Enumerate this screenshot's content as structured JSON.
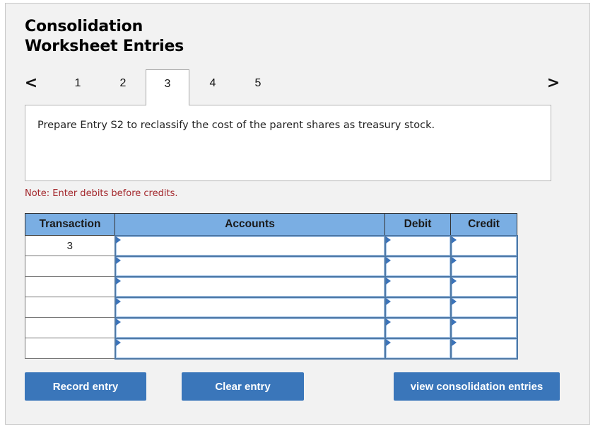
{
  "header": {
    "title_line1": "Consolidation",
    "title_line2": "Worksheet Entries"
  },
  "pager": {
    "prev_icon": "chevron-left-icon",
    "prev_glyph": "<",
    "next_icon": "chevron-right-icon",
    "next_glyph": ">",
    "tabs": [
      {
        "label": "1",
        "active": false
      },
      {
        "label": "2",
        "active": false
      },
      {
        "label": "3",
        "active": true
      },
      {
        "label": "4",
        "active": false
      },
      {
        "label": "5",
        "active": false
      }
    ]
  },
  "question": {
    "text": "Prepare Entry S2 to reclassify the cost of the parent shares as treasury stock."
  },
  "note": "Note: Enter debits before credits.",
  "table": {
    "columns": [
      "Transaction",
      "Accounts",
      "Debit",
      "Credit"
    ],
    "rows": [
      {
        "transaction": "3",
        "account": "",
        "debit": "",
        "credit": ""
      },
      {
        "transaction": "",
        "account": "",
        "debit": "",
        "credit": ""
      },
      {
        "transaction": "",
        "account": "",
        "debit": "",
        "credit": ""
      },
      {
        "transaction": "",
        "account": "",
        "debit": "",
        "credit": ""
      },
      {
        "transaction": "",
        "account": "",
        "debit": "",
        "credit": ""
      },
      {
        "transaction": "",
        "account": "",
        "debit": "",
        "credit": ""
      }
    ]
  },
  "buttons": {
    "record": "Record entry",
    "clear": "Clear entry",
    "view": "view consolidation entries"
  },
  "colors": {
    "header_fill": "#7aaee3",
    "button_fill": "#3a76ba",
    "note_text": "#a3262b",
    "input_border": "#4f79a6",
    "dropdown_marker": "#3b73b9"
  }
}
